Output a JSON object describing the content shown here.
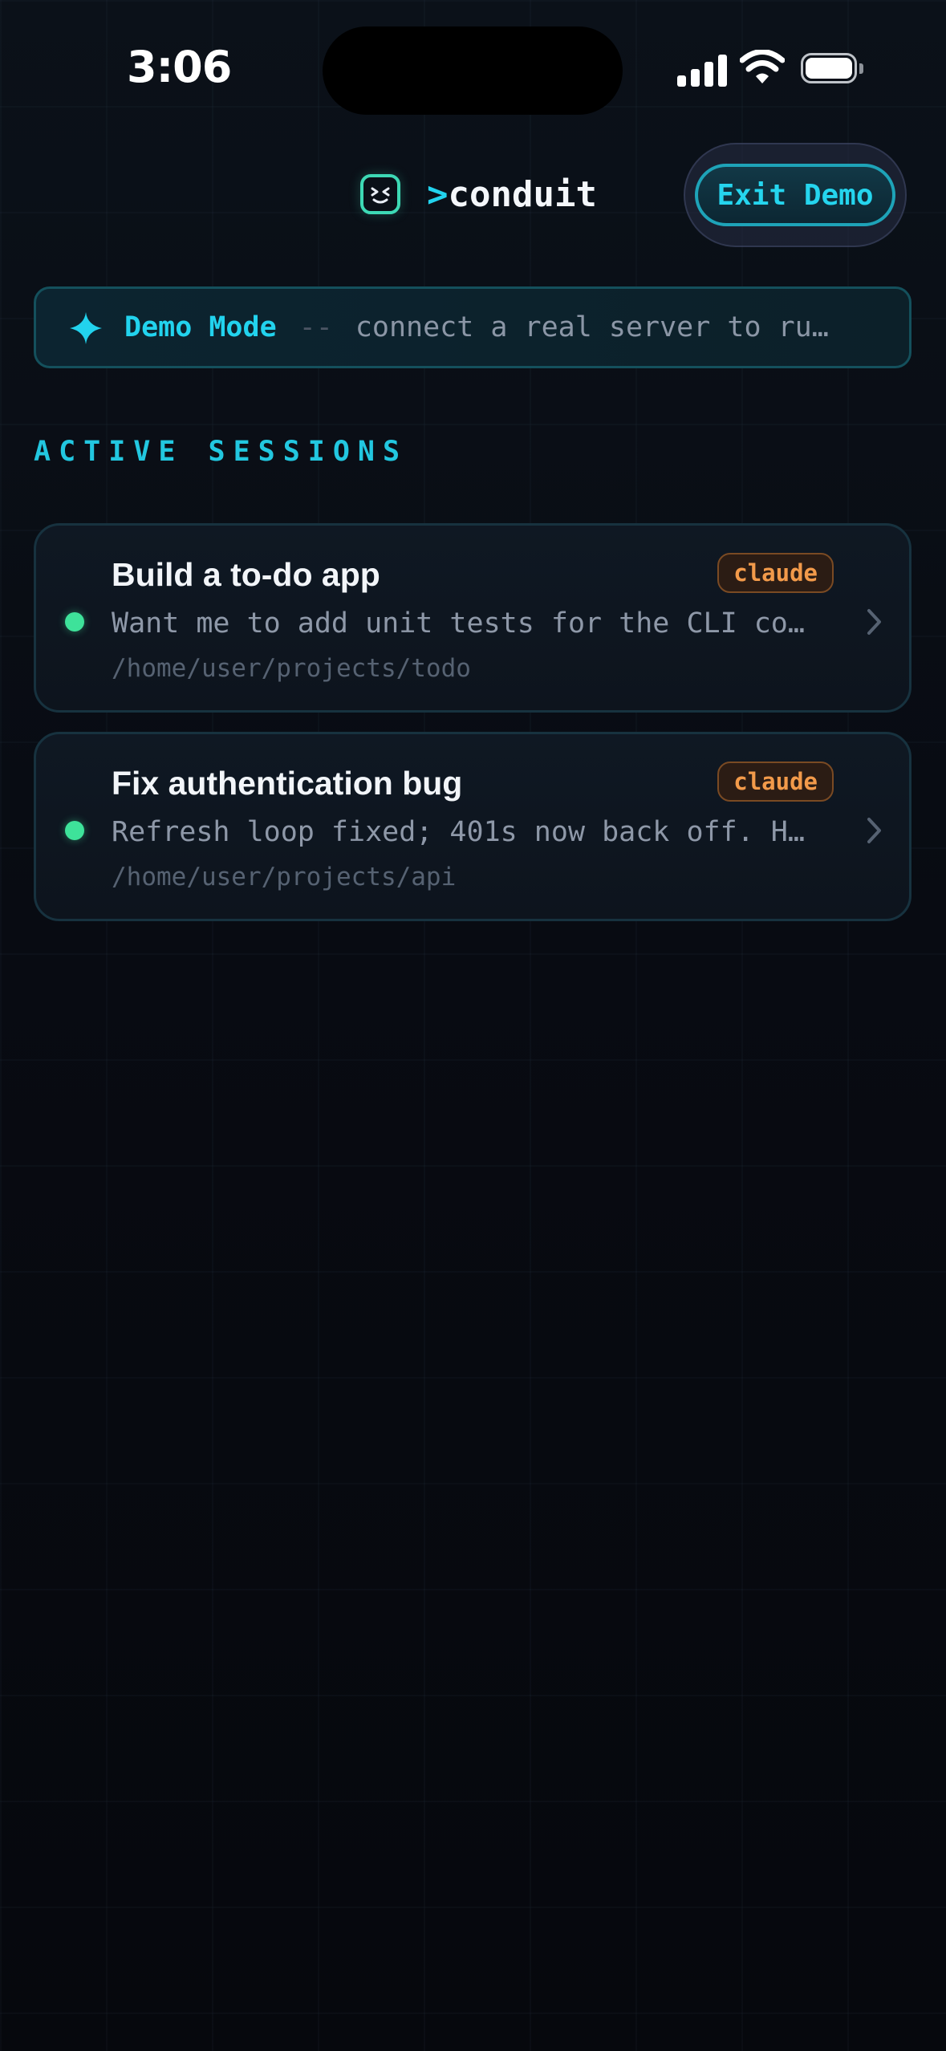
{
  "status_bar": {
    "time": "3:06",
    "signal_icon": "cellular-signal-icon",
    "wifi_icon": "wifi-icon",
    "battery_icon": "battery-icon"
  },
  "header": {
    "logo_icon": "smiley-face-icon",
    "title_prompt": ">",
    "title_name": "conduit",
    "exit_button_label": "Exit Demo"
  },
  "demo_banner": {
    "icon": "sparkle-icon",
    "mode_label": "Demo Mode",
    "separator": "--",
    "message": "connect a real server to ru…"
  },
  "sessions_section": {
    "heading": "ACTIVE SESSIONS",
    "items": [
      {
        "title": "Build a to-do app",
        "agent": "claude",
        "preview": "Want me to add unit tests for the CLI co…",
        "path": "/home/user/projects/todo",
        "status_color": "#3ee29a"
      },
      {
        "title": "Fix authentication bug",
        "agent": "claude",
        "preview": "Refresh loop fixed; 401s now back off. H…",
        "path": "/home/user/projects/api",
        "status_color": "#3ee29a"
      }
    ]
  },
  "colors": {
    "accent": "#22d3ee",
    "logo": "#3dd9b5",
    "badge": "#f29a4a",
    "background": "#07090f"
  }
}
